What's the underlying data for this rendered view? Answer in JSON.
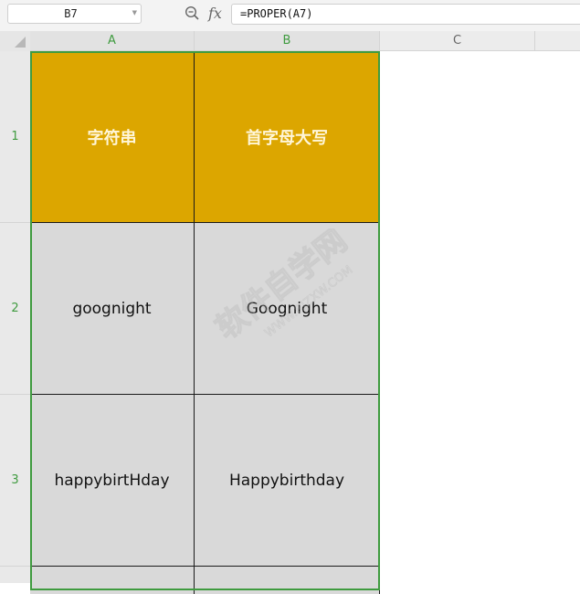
{
  "formula_bar": {
    "name_box": "B7",
    "formula": "=PROPER(A7)"
  },
  "columns": [
    "A",
    "B",
    "C"
  ],
  "rows": [
    "1",
    "2",
    "3"
  ],
  "cells": {
    "a1": "字符串",
    "b1": "首字母大写",
    "a2": "goognight",
    "b2": "Goognight",
    "a3": "happybirtHday",
    "b3": "Happybirthday"
  },
  "watermark": {
    "main": "软件自学网",
    "sub": "WWW.RJZXW.COM"
  },
  "colors": {
    "header_fill": "#dca600",
    "data_fill": "#d9d9d9",
    "selection": "#3f9b3f"
  }
}
